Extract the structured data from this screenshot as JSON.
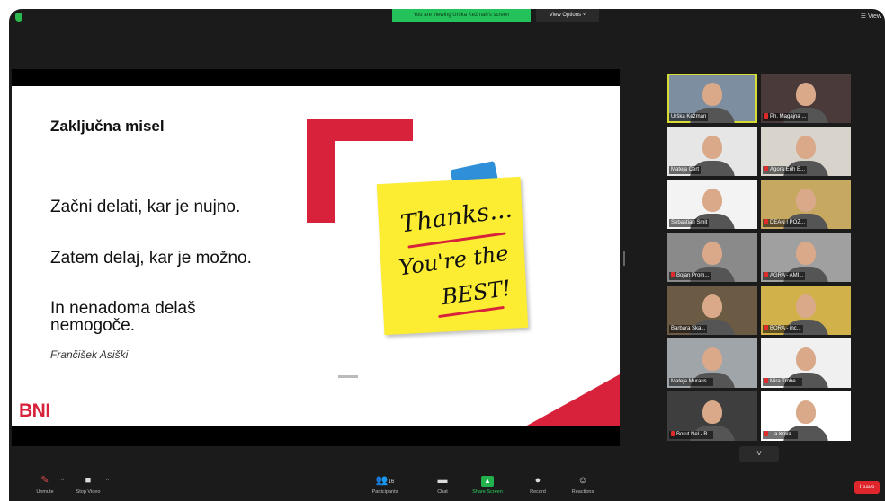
{
  "topbar": {
    "viewing_text": "You are viewing Urška Kežmah's screen",
    "view_options": "View Options ˅",
    "view_button": "☰ View"
  },
  "slide": {
    "title": "Zaključna misel",
    "lines": [
      "Začni delati, kar je nujno.",
      "Zatem delaj, kar je možno.",
      "In nenadoma delaš nemogoče."
    ],
    "attribution": "Frančišek Asiški",
    "logo": "BNI",
    "note_lines": [
      "Thanks...",
      "You're the",
      "BEST!"
    ]
  },
  "participants": [
    {
      "name": "Urška Kežman",
      "muted": false,
      "active": true,
      "bg": "#7c8ea0"
    },
    {
      "name": "Ph. Magajna ...",
      "muted": true,
      "active": false,
      "bg": "#4a3a3a"
    },
    {
      "name": "Mateja Cert",
      "muted": false,
      "active": false,
      "bg": "#e6e6e6"
    },
    {
      "name": "Agora Erih E...",
      "muted": true,
      "active": false,
      "bg": "#d8d4cc"
    },
    {
      "name": "Sebastian Smit",
      "muted": false,
      "active": false,
      "bg": "#f3f3f3"
    },
    {
      "name": "DEAN I POŽ...",
      "muted": true,
      "active": false,
      "bg": "#c7a860"
    },
    {
      "name": "Bojan Prom...",
      "muted": true,
      "active": false,
      "bg": "#8a8a8a"
    },
    {
      "name": "AGRA - AMI...",
      "muted": true,
      "active": false,
      "bg": "#a0a0a0"
    },
    {
      "name": "Barbara Ska...",
      "muted": false,
      "active": false,
      "bg": "#6b5a44"
    },
    {
      "name": "BORA - inc...",
      "muted": true,
      "active": false,
      "bg": "#d1b24a"
    },
    {
      "name": "Mateja Muraus...",
      "muted": false,
      "active": false,
      "bg": "#9fa5a9"
    },
    {
      "name": "Mira Trobe...",
      "muted": true,
      "active": false,
      "bg": "#f0f0f0"
    },
    {
      "name": "Borut Nel - B...",
      "muted": true,
      "active": false,
      "bg": "#3e3e3e"
    },
    {
      "name": "...a Kriva...",
      "muted": true,
      "active": false,
      "bg": "#ffffff"
    }
  ],
  "controls": [
    {
      "name": "unmute",
      "label": "Unmute",
      "icon": "✎"
    },
    {
      "name": "stop-video",
      "label": "Stop Video",
      "icon": "■"
    },
    {
      "name": "participants",
      "label": "Participants",
      "icon": "👥"
    },
    {
      "name": "chat",
      "label": "Chat",
      "icon": "▬"
    },
    {
      "name": "share-screen",
      "label": "Share Screen",
      "icon": "▲"
    },
    {
      "name": "record",
      "label": "Record",
      "icon": "●"
    },
    {
      "name": "reactions",
      "label": "Reactions",
      "icon": "☺"
    }
  ],
  "participants_count": "16",
  "leave_label": "Leave",
  "scroll_label": "˅"
}
